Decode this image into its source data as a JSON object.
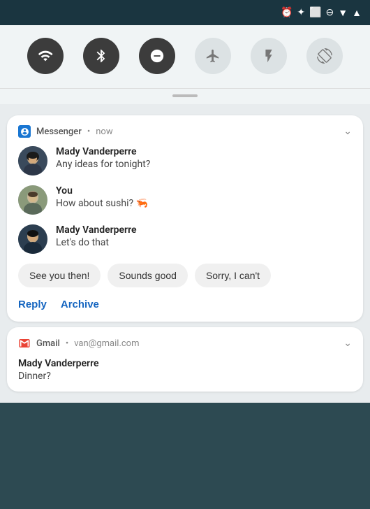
{
  "status_bar": {
    "icons": [
      "alarm",
      "bluetooth",
      "cast",
      "dnd",
      "wifi",
      "signal"
    ]
  },
  "quick_settings": {
    "buttons": [
      {
        "name": "wifi",
        "label": "▼",
        "state": "active"
      },
      {
        "name": "bluetooth",
        "label": "bluetooth",
        "state": "active"
      },
      {
        "name": "dnd",
        "label": "dnd",
        "state": "active"
      },
      {
        "name": "airplane",
        "label": "airplane",
        "state": "inactive"
      },
      {
        "name": "flashlight",
        "label": "flashlight",
        "state": "inactive"
      },
      {
        "name": "rotate",
        "label": "rotate",
        "state": "inactive"
      }
    ]
  },
  "messenger_notif": {
    "app_name": "Messenger",
    "time": "now",
    "messages": [
      {
        "sender": "Mady Vanderperre",
        "text": "Any ideas for tonight?",
        "avatar_type": "mady"
      },
      {
        "sender": "You",
        "text": "How about sushi? 🦐",
        "avatar_type": "you"
      },
      {
        "sender": "Mady Vanderperre",
        "text": "Let's do that",
        "avatar_type": "mady"
      }
    ],
    "quick_replies": [
      "See you then!",
      "Sounds good",
      "Sorry, I can't"
    ],
    "actions": [
      {
        "label": "Reply",
        "name": "reply-action"
      },
      {
        "label": "Archive",
        "name": "archive-action"
      }
    ]
  },
  "gmail_notif": {
    "app_name": "Gmail",
    "account": "van@gmail.com",
    "sender": "Mady Vanderperre",
    "subject": "Dinner?"
  }
}
